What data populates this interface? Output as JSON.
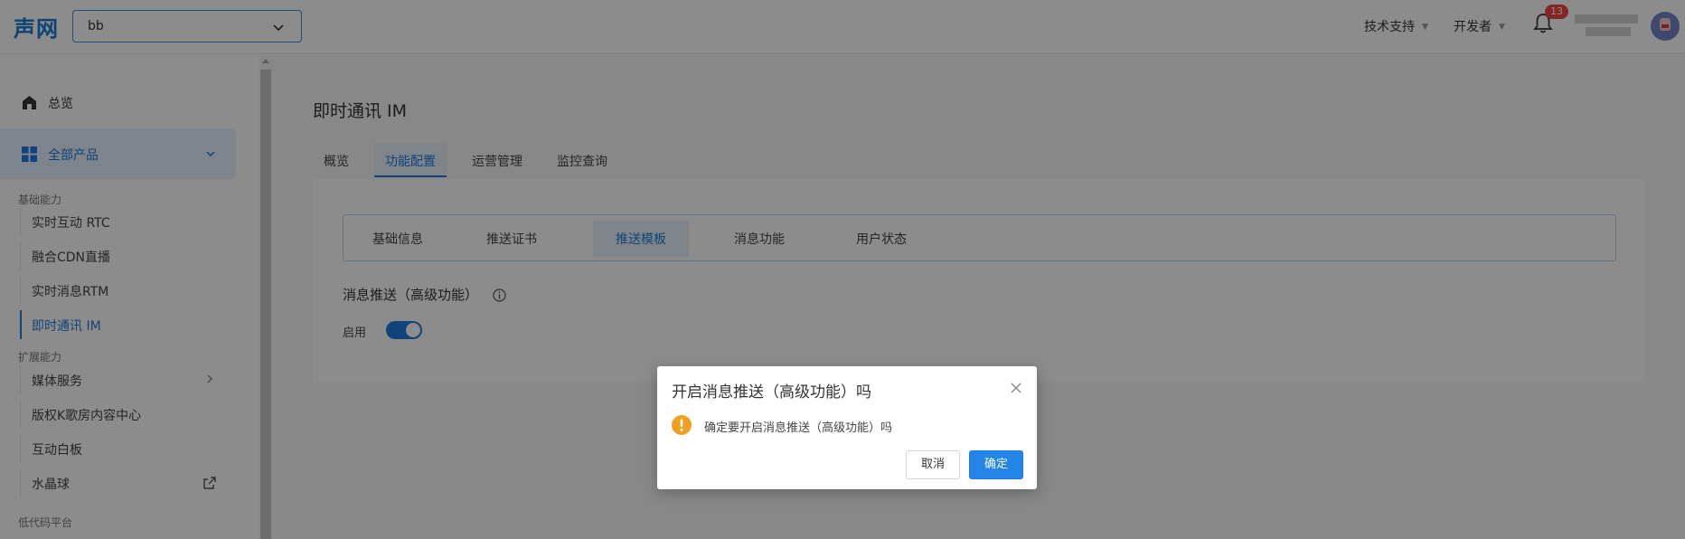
{
  "header": {
    "logo": "声网",
    "project_select": {
      "value": "bb"
    },
    "links": [
      {
        "label": "技术支持"
      },
      {
        "label": "开发者"
      }
    ],
    "notifications_count": "13",
    "icons": {
      "bell": "bell-icon",
      "chevron": "chevron-down-icon",
      "avatar": "user-avatar"
    }
  },
  "sidebar": {
    "overview": {
      "label": "总览",
      "icon": "home-icon"
    },
    "all_products": {
      "label": "全部产品",
      "icon": "grid-icon"
    },
    "groups": [
      {
        "title": "基础能力",
        "items": [
          {
            "label": "实时互动 RTC"
          },
          {
            "label": "融合CDN直播"
          },
          {
            "label": "实时消息RTM"
          },
          {
            "label": "即时通讯 IM",
            "active": true
          }
        ]
      },
      {
        "title": "扩展能力",
        "items": [
          {
            "label": "媒体服务",
            "icon": "chevron-right-icon"
          },
          {
            "label": "版权K歌房内容中心"
          },
          {
            "label": "互动白板"
          },
          {
            "label": "水晶球",
            "icon": "external-link-icon"
          }
        ]
      },
      {
        "title": "低代码平台",
        "items": []
      }
    ]
  },
  "main": {
    "title": "即时通讯 IM",
    "tabs": [
      {
        "label": "概览"
      },
      {
        "label": "功能配置",
        "active": true
      },
      {
        "label": "运营管理"
      },
      {
        "label": "监控查询"
      }
    ],
    "subtabs": [
      {
        "label": "基础信息"
      },
      {
        "label": "推送证书"
      },
      {
        "label": "推送模板",
        "active": true
      },
      {
        "label": "消息功能"
      },
      {
        "label": "用户状态"
      }
    ],
    "section_title": "消息推送（高级功能）",
    "enable_label": "启用",
    "toggle_on": true
  },
  "modal": {
    "title": "开启消息推送（高级功能）吗",
    "message": "确定要开启消息推送（高级功能）吗",
    "cancel_label": "取消",
    "ok_label": "确定",
    "icons": {
      "warn": "warning-icon",
      "close": "close-icon"
    }
  },
  "colors": {
    "accent": "#1e7be0",
    "active_bg": "#e8f1fc",
    "warning": "#f0a020",
    "badge": "#f5453f"
  }
}
